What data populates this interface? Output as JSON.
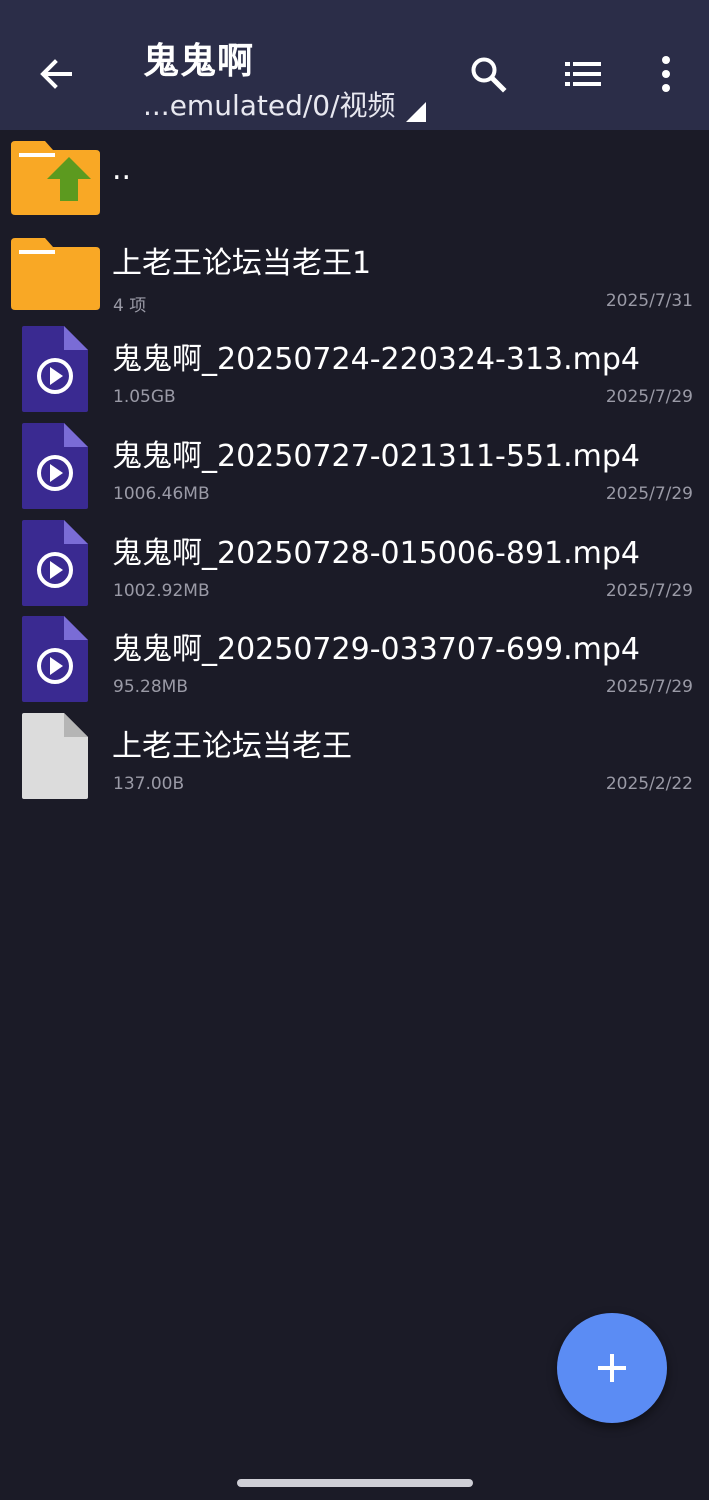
{
  "header": {
    "title": "鬼鬼啊",
    "path": "...emulated/0/视频"
  },
  "icons": {
    "back": "arrow-left-icon",
    "search": "search-icon",
    "view": "list-view-icon",
    "more": "more-vertical-icon",
    "fab": "plus-icon"
  },
  "colors": {
    "topbar": "#2b2d48",
    "background": "#1b1b27",
    "folder": "#f9a825",
    "video_file": "#3a2a91",
    "fab": "#5b8cf4"
  },
  "files": [
    {
      "type": "parent",
      "name": "..",
      "meta": "",
      "date": ""
    },
    {
      "type": "folder",
      "name": "上老王论坛当老王1",
      "meta": "4 项",
      "date": "2025/7/31"
    },
    {
      "type": "video",
      "name": "鬼鬼啊_20250724-220324-313.mp4",
      "meta": "1.05GB",
      "date": "2025/7/29"
    },
    {
      "type": "video",
      "name": "鬼鬼啊_20250727-021311-551.mp4",
      "meta": "1006.46MB",
      "date": "2025/7/29"
    },
    {
      "type": "video",
      "name": "鬼鬼啊_20250728-015006-891.mp4",
      "meta": "1002.92MB",
      "date": "2025/7/29"
    },
    {
      "type": "video",
      "name": "鬼鬼啊_20250729-033707-699.mp4",
      "meta": "95.28MB",
      "date": "2025/7/29"
    },
    {
      "type": "file",
      "name": "上老王论坛当老王",
      "meta": "137.00B",
      "date": "2025/2/22"
    }
  ]
}
